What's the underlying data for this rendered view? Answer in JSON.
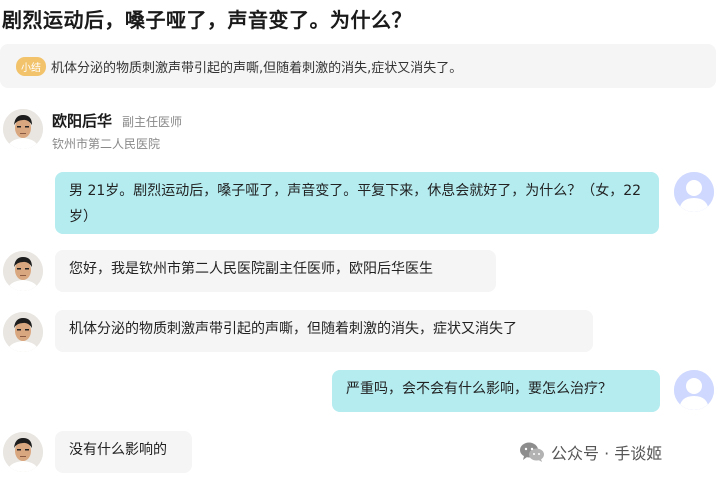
{
  "question_title": "剧烈运动后，嗓子哑了，声音变了。为什么？",
  "summary": {
    "tag": "小结",
    "text": "机体分泌的物质刺激声带引起的声嘶,但随着刺激的消失,症状又消失了。"
  },
  "doctor": {
    "name": "欧阳后华",
    "title": "副主任医师",
    "hospital": "钦州市第二人民医院"
  },
  "messages": [
    {
      "from": "patient",
      "text": "男 21岁。剧烈运动后，嗓子哑了，声音变了。平复下来，休息会就好了，为什么？（女，22岁）"
    },
    {
      "from": "doctor",
      "text": "您好，我是钦州市第二人民医院副主任医师，欧阳后华医生"
    },
    {
      "from": "doctor",
      "text": "机体分泌的物质刺激声带引起的声嘶，但随着刺激的消失，症状又消失了"
    },
    {
      "from": "patient",
      "text": "严重吗，会不会有什么影响，要怎么治疗？"
    },
    {
      "from": "doctor",
      "text": "没有什么影响的"
    }
  ],
  "watermark": "公众号 · 手谈姬",
  "colors": {
    "patient_bubble": "#b4ecf0",
    "doctor_bubble": "#f5f5f5",
    "summary_tag": "#f2c36b",
    "patient_avatar": "#cfd8ff"
  }
}
